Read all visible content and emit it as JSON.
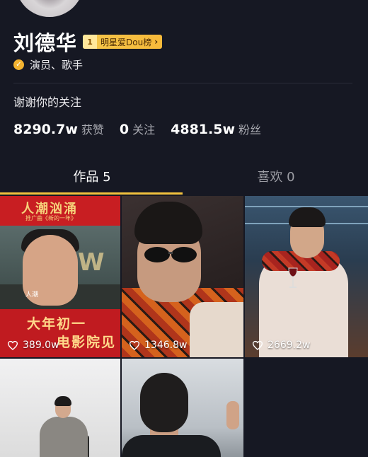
{
  "profile": {
    "name": "刘德华",
    "rank_number": "1",
    "rank_label": "明星爱Dou榜",
    "rank_arrow": "›",
    "verification": "演员、歌手",
    "bio": "谢谢你的关注"
  },
  "stats": [
    {
      "value": "8290.7w",
      "label": "获赞"
    },
    {
      "value": "0",
      "label": "关注"
    },
    {
      "value": "4881.5w",
      "label": "粉丝"
    }
  ],
  "tabs": [
    {
      "label": "作品 5",
      "active": true
    },
    {
      "label": "喜欢 0",
      "active": false
    }
  ],
  "posts": [
    {
      "likes": "389.0w",
      "poster_top": "大年初一",
      "poster_bottom": "电影院见",
      "poster_banner": "人潮汹涌",
      "poster_sub": "推广曲《新的一年》",
      "poster_w": "W",
      "poster_tag": "人潮"
    },
    {
      "likes": "1346.8w"
    },
    {
      "likes": "2669.2w"
    },
    {},
    {}
  ],
  "colors": {
    "background": "#161823",
    "accent": "#f2c23e",
    "verify": "#f3b330"
  }
}
